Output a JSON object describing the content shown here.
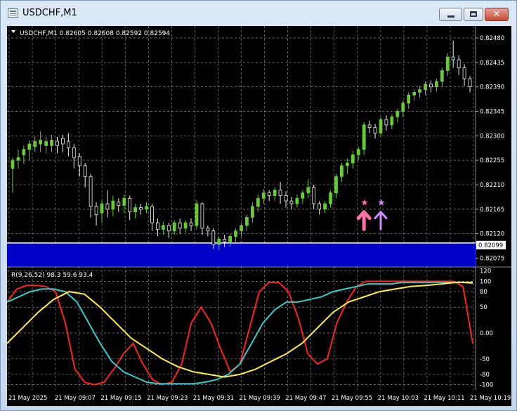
{
  "window": {
    "title": "USDCHF,M1"
  },
  "chart_data": [
    {
      "type": "candlestick",
      "symbol_header": "USDCHF,M1  0.82605 0.82608 0.82592 0.82594",
      "y_tick_labels": [
        "0.82480",
        "0.82435",
        "0.82390",
        "0.82345",
        "0.82300",
        "0.82255",
        "0.82210",
        "0.82165",
        "0.82120",
        "0.82075"
      ],
      "ylim": [
        0.8206,
        0.82502
      ],
      "current_price_label": "0.82099",
      "x_tick_labels": [
        "21 May 2025",
        "21 May 09:07",
        "21 May 09:15",
        "21 May 09:23",
        "21 May 09:31",
        "21 May 09:39",
        "21 May 09:47",
        "21 May 09:55",
        "21 May 10:03",
        "21 May 10:11",
        "21 May 10:19"
      ],
      "candles": [
        [
          0.8224,
          0.82255,
          0.82232,
          0.8226,
          0.82195
        ],
        [
          0.82255,
          0.8226,
          0.8225,
          0.82275,
          0.8224
        ],
        [
          0.82265,
          0.82275,
          0.82255,
          0.82282,
          0.82248
        ],
        [
          0.82275,
          0.82285,
          0.82265,
          0.82292,
          0.82255
        ],
        [
          0.8228,
          0.8229,
          0.82275,
          0.823,
          0.8227
        ],
        [
          0.82285,
          0.82292,
          0.82278,
          0.82308,
          0.8227
        ],
        [
          0.82282,
          0.8229,
          0.82275,
          0.82298,
          0.82268
        ],
        [
          0.82282,
          0.82292,
          0.82278,
          0.82302,
          0.8227
        ],
        [
          0.8229,
          0.82282,
          0.82275,
          0.82298,
          0.82268
        ],
        [
          0.82295,
          0.82285,
          0.82278,
          0.82302,
          0.8227
        ],
        [
          0.8229,
          0.82278,
          0.8227,
          0.82305,
          0.82262
        ],
        [
          0.82278,
          0.8226,
          0.8225,
          0.82285,
          0.8224
        ],
        [
          0.82262,
          0.82245,
          0.82235,
          0.82268,
          0.82225
        ],
        [
          0.82245,
          0.82225,
          0.82215,
          0.8225,
          0.82205
        ],
        [
          0.82225,
          0.8217,
          0.8216,
          0.8223,
          0.8215
        ],
        [
          0.8217,
          0.82155,
          0.82145,
          0.82178,
          0.82135
        ],
        [
          0.82158,
          0.82175,
          0.8215,
          0.82182,
          0.8214
        ],
        [
          0.82175,
          0.82165,
          0.82158,
          0.822,
          0.8215
        ],
        [
          0.82165,
          0.8218,
          0.8216,
          0.8219,
          0.82152
        ],
        [
          0.82178,
          0.82172,
          0.82165,
          0.82185,
          0.8216
        ],
        [
          0.82172,
          0.82185,
          0.82165,
          0.82192,
          0.82158
        ],
        [
          0.82185,
          0.8216,
          0.82152,
          0.8219,
          0.82145
        ],
        [
          0.8216,
          0.82168,
          0.82155,
          0.82175,
          0.82148
        ],
        [
          0.82168,
          0.82165,
          0.8216,
          0.82175,
          0.82155
        ],
        [
          0.82165,
          0.8217,
          0.82162,
          0.82178,
          0.82158
        ],
        [
          0.8217,
          0.8214,
          0.8213,
          0.82175,
          0.82125
        ],
        [
          0.8214,
          0.82128,
          0.8212,
          0.82148,
          0.82115
        ],
        [
          0.82128,
          0.82135,
          0.82122,
          0.82142,
          0.82118
        ],
        [
          0.82135,
          0.82125,
          0.82118,
          0.8214,
          0.82112
        ],
        [
          0.82125,
          0.8214,
          0.8212,
          0.82145,
          0.82118
        ],
        [
          0.8214,
          0.8213,
          0.82125,
          0.82148,
          0.8212
        ],
        [
          0.8213,
          0.8214,
          0.82125,
          0.82145,
          0.82122
        ],
        [
          0.8214,
          0.82135,
          0.8213,
          0.82148,
          0.82125
        ],
        [
          0.82135,
          0.82175,
          0.82132,
          0.82182,
          0.82128
        ],
        [
          0.82175,
          0.8213,
          0.82122,
          0.82178,
          0.82118
        ],
        [
          0.8213,
          0.82125,
          0.82118,
          0.82135,
          0.82115
        ],
        [
          0.82125,
          0.821,
          0.82095,
          0.8213,
          0.82092
        ],
        [
          0.821,
          0.8211,
          0.82095,
          0.82115,
          0.8209
        ],
        [
          0.8211,
          0.82105,
          0.821,
          0.82118,
          0.82095
        ],
        [
          0.82105,
          0.82115,
          0.82098,
          0.8212,
          0.82096
        ],
        [
          0.82115,
          0.82125,
          0.8211,
          0.8213,
          0.82105
        ],
        [
          0.82125,
          0.82135,
          0.8212,
          0.8214,
          0.82115
        ],
        [
          0.82135,
          0.8215,
          0.8213,
          0.82155,
          0.82125
        ],
        [
          0.8215,
          0.8217,
          0.82145,
          0.82178,
          0.8214
        ],
        [
          0.8217,
          0.82185,
          0.82165,
          0.82192,
          0.8216
        ],
        [
          0.82185,
          0.82195,
          0.8218,
          0.82202,
          0.82175
        ],
        [
          0.82195,
          0.8219,
          0.82185,
          0.822,
          0.8218
        ],
        [
          0.8219,
          0.822,
          0.82185,
          0.82205,
          0.8218
        ],
        [
          0.822,
          0.8219,
          0.8218,
          0.82215,
          0.82175
        ],
        [
          0.8219,
          0.8218,
          0.82172,
          0.82198,
          0.82168
        ],
        [
          0.8218,
          0.82175,
          0.8217,
          0.82188,
          0.82165
        ],
        [
          0.82175,
          0.82185,
          0.8217,
          0.82192,
          0.82168
        ],
        [
          0.82185,
          0.82195,
          0.8218,
          0.822,
          0.82175
        ],
        [
          0.82195,
          0.82205,
          0.8219,
          0.8222,
          0.82185
        ],
        [
          0.82205,
          0.82175,
          0.8217,
          0.8221,
          0.82165
        ],
        [
          0.82175,
          0.82165,
          0.8216,
          0.8218,
          0.82155
        ],
        [
          0.82165,
          0.82175,
          0.8216,
          0.8218,
          0.82158
        ],
        [
          0.82175,
          0.82195,
          0.8217,
          0.822,
          0.82168
        ],
        [
          0.82195,
          0.82225,
          0.8219,
          0.8223,
          0.82185
        ],
        [
          0.82225,
          0.82245,
          0.8222,
          0.8225,
          0.82215
        ],
        [
          0.82245,
          0.8225,
          0.82238,
          0.82258,
          0.8223
        ],
        [
          0.8225,
          0.82265,
          0.82245,
          0.82272,
          0.8224
        ],
        [
          0.82265,
          0.82275,
          0.8226,
          0.8228,
          0.82255
        ],
        [
          0.82275,
          0.8232,
          0.8227,
          0.82325,
          0.82265
        ],
        [
          0.8232,
          0.82315,
          0.82308,
          0.82328,
          0.82305
        ],
        [
          0.82315,
          0.82305,
          0.82298,
          0.82322,
          0.82295
        ],
        [
          0.82305,
          0.8233,
          0.823,
          0.82335,
          0.82298
        ],
        [
          0.8233,
          0.8232,
          0.82315,
          0.82338,
          0.8231
        ],
        [
          0.8232,
          0.82335,
          0.82315,
          0.8234,
          0.82312
        ],
        [
          0.82335,
          0.82345,
          0.8233,
          0.8235,
          0.82325
        ],
        [
          0.82345,
          0.8236,
          0.8234,
          0.82365,
          0.82335
        ],
        [
          0.8236,
          0.82375,
          0.82355,
          0.8238,
          0.8235
        ],
        [
          0.82375,
          0.8238,
          0.8237,
          0.82385,
          0.82365
        ],
        [
          0.8238,
          0.82385,
          0.82375,
          0.82392,
          0.8237
        ],
        [
          0.82385,
          0.82395,
          0.8238,
          0.824,
          0.82375
        ],
        [
          0.82395,
          0.8239,
          0.82385,
          0.82402,
          0.8238
        ],
        [
          0.8239,
          0.824,
          0.82385,
          0.82405,
          0.82382
        ],
        [
          0.824,
          0.8242,
          0.82395,
          0.82425,
          0.8239
        ],
        [
          0.8242,
          0.82445,
          0.82415,
          0.82452,
          0.8241
        ],
        [
          0.82445,
          0.8244,
          0.82432,
          0.82475,
          0.82425
        ],
        [
          0.8244,
          0.82425,
          0.82418,
          0.82448,
          0.82412
        ],
        [
          0.82425,
          0.82405,
          0.82398,
          0.82432,
          0.82392
        ],
        [
          0.82405,
          0.8239,
          0.82385,
          0.8241,
          0.8238
        ]
      ],
      "candle_fields": [
        "open",
        "close",
        "low_body",
        "high",
        "low"
      ],
      "signals": [
        {
          "type": "star",
          "index": 63,
          "color": "#ff6fa8"
        },
        {
          "type": "star",
          "index": 66,
          "color": "#d08cff"
        },
        {
          "type": "arrow-up",
          "index": 63,
          "color": "#ff6fa8"
        },
        {
          "type": "arrow-up",
          "index": 66,
          "color": "#d08cff"
        }
      ],
      "colors": {
        "up": "#66cc33",
        "down": "#f2f2e6",
        "grid": "#8a8a8a",
        "band": "#0000c8",
        "text": "#ffffff"
      }
    },
    {
      "type": "line",
      "header": "R(9,26,52) 98.3 59.6 93.4",
      "y_tick_labels": [
        "120",
        "100",
        "80",
        "50",
        "0.00",
        "-50",
        "-80",
        "-100"
      ],
      "ylim": [
        -110,
        125
      ],
      "series": [
        {
          "color": "#ff2020",
          "values": [
            60,
            85,
            92,
            92,
            90,
            80,
            20,
            -70,
            -95,
            -100,
            -95,
            -70,
            -40,
            -20,
            -60,
            -90,
            -100,
            -95,
            -60,
            20,
            50,
            20,
            -30,
            -75,
            -60,
            10,
            80,
            98,
            98,
            80,
            30,
            -40,
            -60,
            -50,
            20,
            60,
            90,
            100,
            100,
            100,
            100,
            100,
            100,
            100,
            100,
            100,
            100,
            90,
            -20
          ]
        },
        {
          "color": "#33cccc",
          "values": [
            60,
            70,
            80,
            85,
            85,
            80,
            60,
            20,
            -20,
            -55,
            -75,
            -85,
            -95,
            -98,
            -98,
            -98,
            -98,
            -95,
            -90,
            -80,
            -60,
            -20,
            20,
            45,
            60,
            60,
            65,
            70,
            80,
            85,
            90,
            95,
            95,
            95,
            98,
            98,
            98,
            98,
            98,
            98,
            96
          ]
        },
        {
          "color": "#ffee44",
          "values": [
            -20,
            10,
            40,
            65,
            80,
            75,
            50,
            20,
            -10,
            -30,
            -50,
            -65,
            -75,
            -80,
            -85,
            -80,
            -70,
            -55,
            -40,
            -20,
            10,
            40,
            60,
            70,
            80,
            85,
            90,
            92,
            95,
            98,
            98
          ]
        }
      ]
    }
  ]
}
